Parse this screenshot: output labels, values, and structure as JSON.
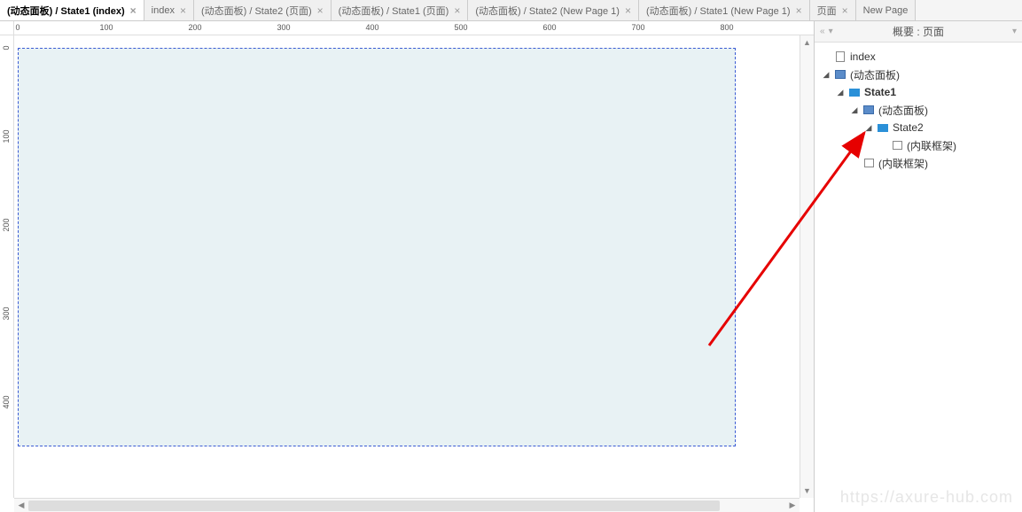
{
  "tabs": [
    {
      "label": "(动态面板) / State1 (index)",
      "active": true
    },
    {
      "label": "index",
      "active": false
    },
    {
      "label": "(动态面板) / State2 (页面)",
      "active": false
    },
    {
      "label": "(动态面板) / State1 (页面)",
      "active": false
    },
    {
      "label": "(动态面板) / State2 (New Page 1)",
      "active": false
    },
    {
      "label": "(动态面板) / State1 (New Page 1)",
      "active": false
    },
    {
      "label": "页面",
      "active": false
    },
    {
      "label": "New Page",
      "active": false
    }
  ],
  "ruler": {
    "h": [
      "0",
      "100",
      "200",
      "300",
      "400",
      "500",
      "600",
      "700",
      "800"
    ],
    "v": [
      "0",
      "100",
      "200",
      "300",
      "400"
    ]
  },
  "panel": {
    "title": "概要 : 页面"
  },
  "tree": [
    {
      "indent": 0,
      "caret": "none",
      "icon": "page",
      "label": "index",
      "bold": false
    },
    {
      "indent": 0,
      "caret": "open",
      "icon": "panel",
      "label": "(动态面板)",
      "bold": false
    },
    {
      "indent": 1,
      "caret": "open",
      "icon": "state",
      "label": "State1",
      "bold": true
    },
    {
      "indent": 2,
      "caret": "open",
      "icon": "panel",
      "label": "(动态面板)",
      "bold": false
    },
    {
      "indent": 3,
      "caret": "open",
      "icon": "state",
      "label": "State2",
      "bold": false
    },
    {
      "indent": 4,
      "caret": "none",
      "icon": "iframe",
      "label": "(内联框架)",
      "bold": false
    },
    {
      "indent": 2,
      "caret": "none",
      "icon": "iframe",
      "label": "(内联框架)",
      "bold": false
    }
  ],
  "watermark": "https://axure-hub.com"
}
